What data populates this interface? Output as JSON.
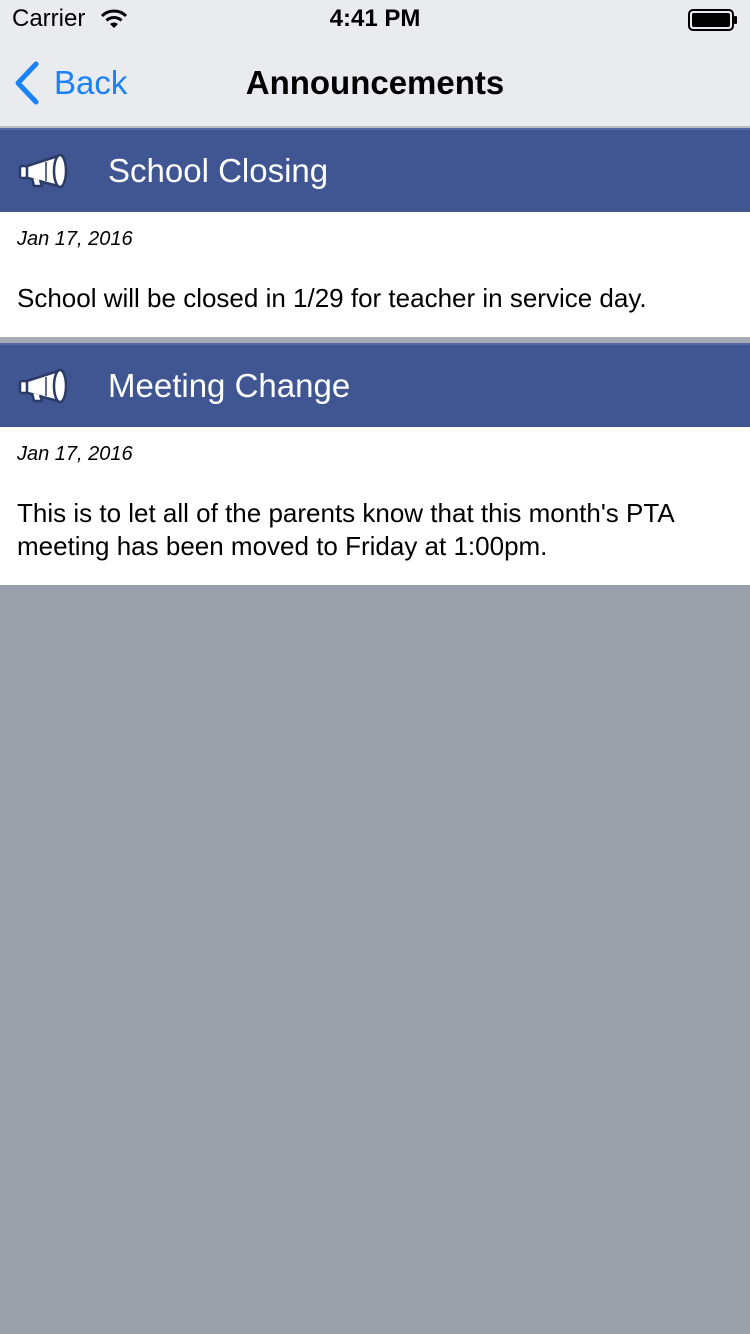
{
  "status_bar": {
    "carrier": "Carrier",
    "time": "4:41 PM"
  },
  "nav": {
    "back_label": "Back",
    "title": "Announcements",
    "accent_color": "#1a82f7"
  },
  "announcements": [
    {
      "title": "School Closing",
      "date": "Jan 17, 2016",
      "body": "School will be closed in 1/29 for teacher in service day.",
      "icon": "megaphone-icon"
    },
    {
      "title": "Meeting Change",
      "date": "Jan 17, 2016",
      "body": "This is to let all of the parents know that this month's PTA meeting has been moved to Friday at 1:00pm.",
      "icon": "megaphone-icon"
    }
  ],
  "colors": {
    "header_bar": "#3f5693",
    "background": "#9aa0aa"
  }
}
